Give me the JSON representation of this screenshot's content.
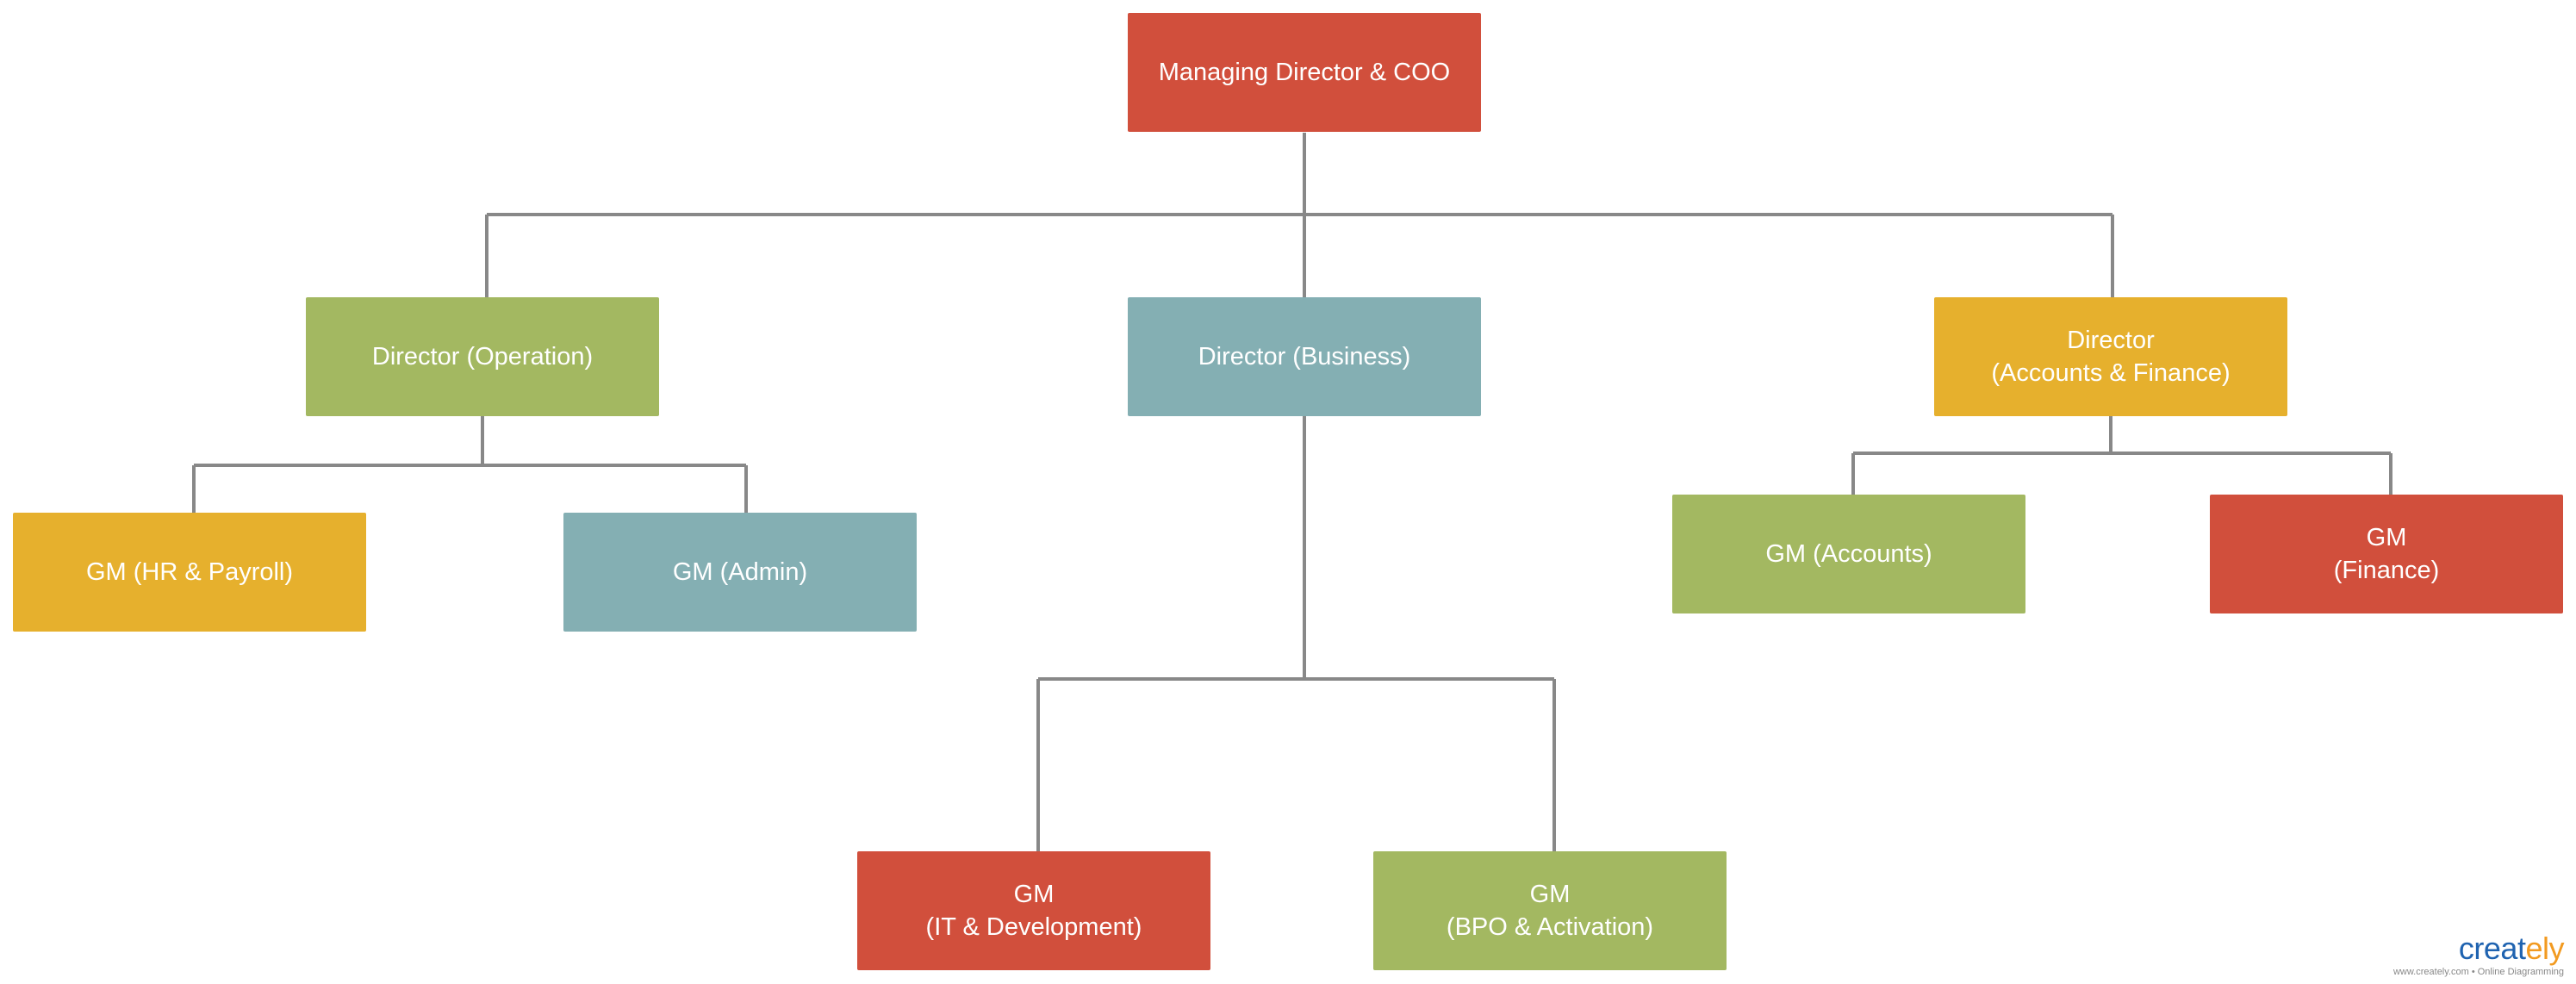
{
  "nodes": {
    "root": {
      "lines": [
        "Managing Director & COO"
      ],
      "color": "#d14f3c"
    },
    "dir_operation": {
      "lines": [
        "Director (Operation)"
      ],
      "color": "#a3b861"
    },
    "dir_business": {
      "lines": [
        "Director (Business)"
      ],
      "color": "#84afb3"
    },
    "dir_accounts_finance": {
      "lines": [
        "Director",
        "(Accounts & Finance)"
      ],
      "color": "#e6b02d"
    },
    "gm_hr": {
      "lines": [
        "GM (HR & Payroll)"
      ],
      "color": "#e6b02d"
    },
    "gm_admin": {
      "lines": [
        "GM (Admin)"
      ],
      "color": "#84afb3"
    },
    "gm_accounts": {
      "lines": [
        "GM (Accounts)"
      ],
      "color": "#a3b861"
    },
    "gm_finance": {
      "lines": [
        "GM",
        "(Finance)"
      ],
      "color": "#d14f3c"
    },
    "gm_it": {
      "lines": [
        "GM",
        "(IT & Development)"
      ],
      "color": "#d14f3c"
    },
    "gm_bpo": {
      "lines": [
        "GM",
        "(BPO & Activation)"
      ],
      "color": "#a3b861"
    }
  },
  "edges": [
    [
      "root",
      "dir_operation"
    ],
    [
      "root",
      "dir_business"
    ],
    [
      "root",
      "dir_accounts_finance"
    ],
    [
      "dir_operation",
      "gm_hr"
    ],
    [
      "dir_operation",
      "gm_admin"
    ],
    [
      "dir_business",
      "gm_it"
    ],
    [
      "dir_business",
      "gm_bpo"
    ],
    [
      "dir_accounts_finance",
      "gm_accounts"
    ],
    [
      "dir_accounts_finance",
      "gm_finance"
    ]
  ],
  "connector_color": "#888888",
  "logo": {
    "brand_main": "creat",
    "brand_accent": "ely",
    "tagline": "www.creately.com • Online Diagramming"
  }
}
